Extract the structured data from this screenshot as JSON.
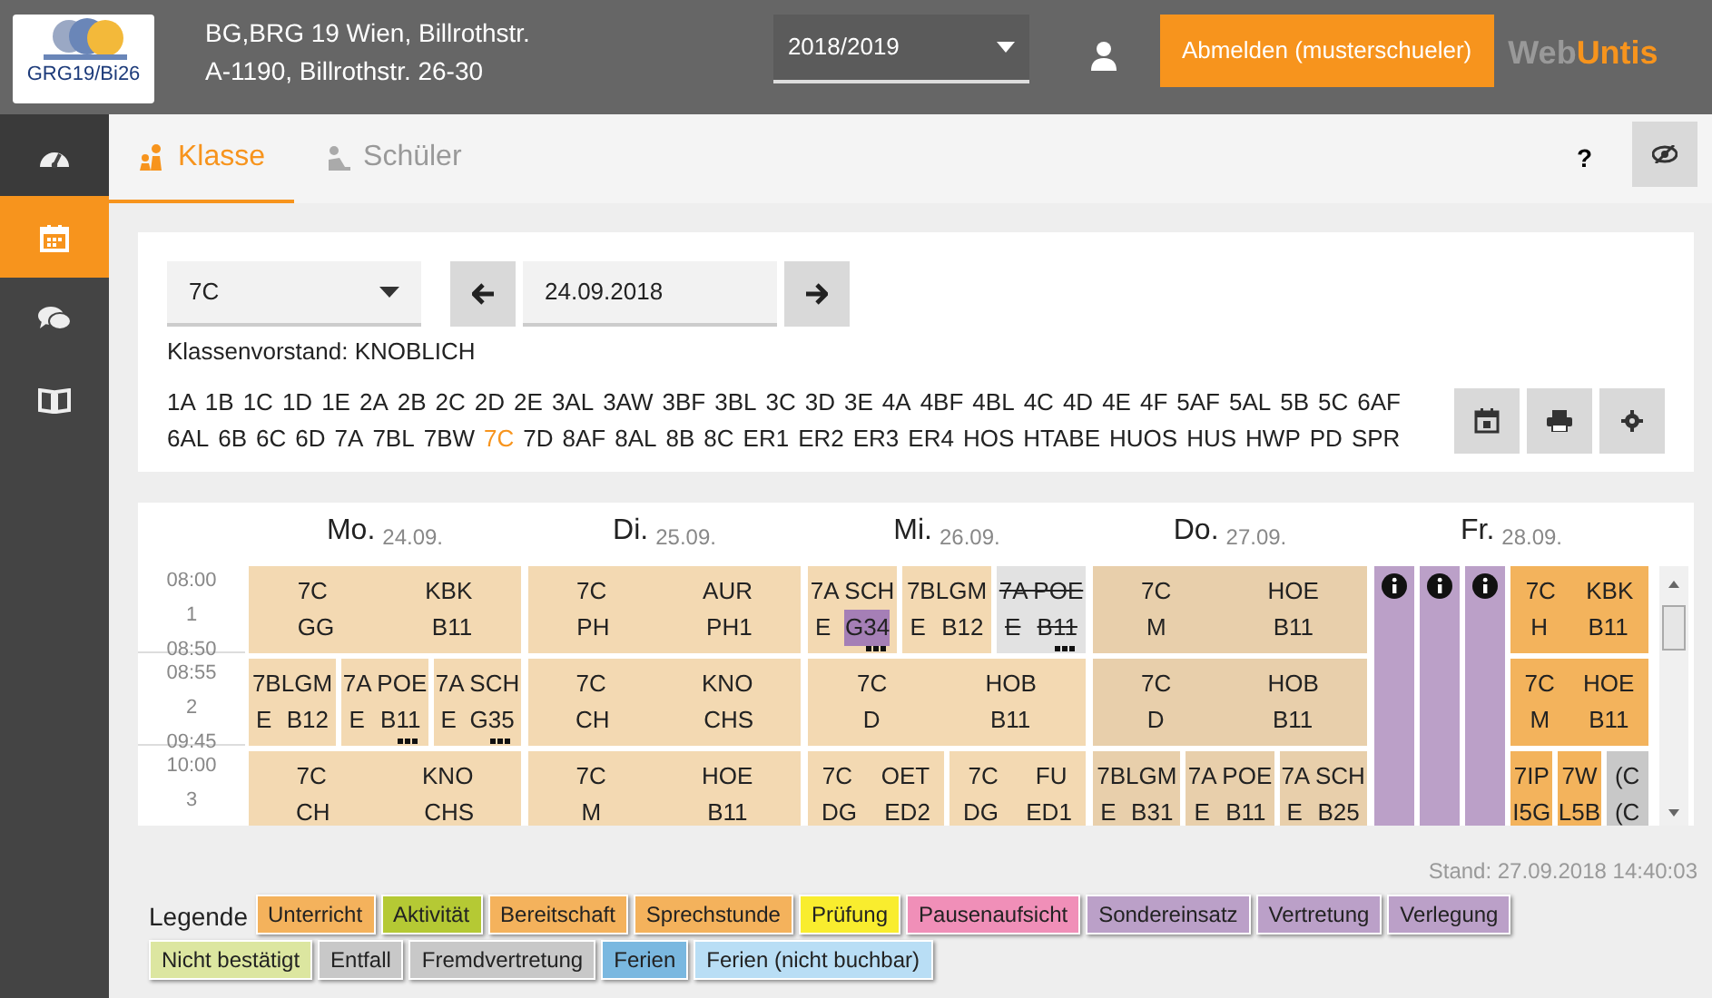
{
  "header": {
    "logo_text": "GRG19/Bi26",
    "school_lines": [
      "BG,BRG 19 Wien, Billrothstr.",
      "A-1190, Billrothstr. 26-30"
    ],
    "school_year": "2018/2019",
    "logout": "Abmelden (musterschueler)",
    "brand": [
      "Web",
      "Untis"
    ]
  },
  "sidebar": [
    {
      "selected": false
    },
    {
      "selected": true
    },
    {
      "selected": false
    },
    {
      "selected": false
    }
  ],
  "tabs": [
    {
      "label": "Klasse",
      "selected": true
    },
    {
      "label": "Schüler",
      "selected": false
    }
  ],
  "toolbar": {
    "help": "?"
  },
  "filter": {
    "class_value": "7C",
    "date": "24.09.2018",
    "class_teacher": "Klassenvorstand: KNOBLICH"
  },
  "classes": [
    {
      "label": "1A",
      "selected": false
    },
    {
      "label": "1B",
      "selected": false
    },
    {
      "label": "1C",
      "selected": false
    },
    {
      "label": "1D",
      "selected": false
    },
    {
      "label": "1E",
      "selected": false
    },
    {
      "label": "2A",
      "selected": false
    },
    {
      "label": "2B",
      "selected": false
    },
    {
      "label": "2C",
      "selected": false
    },
    {
      "label": "2D",
      "selected": false
    },
    {
      "label": "2E",
      "selected": false
    },
    {
      "label": "3AL",
      "selected": false
    },
    {
      "label": "3AW",
      "selected": false
    },
    {
      "label": "3BF",
      "selected": false
    },
    {
      "label": "3BL",
      "selected": false
    },
    {
      "label": "3C",
      "selected": false
    },
    {
      "label": "3D",
      "selected": false
    },
    {
      "label": "3E",
      "selected": false
    },
    {
      "label": "4A",
      "selected": false
    },
    {
      "label": "4BF",
      "selected": false
    },
    {
      "label": "4BL",
      "selected": false
    },
    {
      "label": "4C",
      "selected": false
    },
    {
      "label": "4D",
      "selected": false
    },
    {
      "label": "4E",
      "selected": false
    },
    {
      "label": "4F",
      "selected": false
    },
    {
      "label": "5AF",
      "selected": false
    },
    {
      "label": "5AL",
      "selected": false
    },
    {
      "label": "5B",
      "selected": false
    },
    {
      "label": "5C",
      "selected": false
    },
    {
      "label": "6AF",
      "selected": false
    },
    {
      "label": "6AL",
      "selected": false
    },
    {
      "label": "6B",
      "selected": false
    },
    {
      "label": "6C",
      "selected": false
    },
    {
      "label": "6D",
      "selected": false
    },
    {
      "label": "7A",
      "selected": false
    },
    {
      "label": "7BL",
      "selected": false
    },
    {
      "label": "7BW",
      "selected": false
    },
    {
      "label": "7C",
      "selected": true
    },
    {
      "label": "7D",
      "selected": false
    },
    {
      "label": "8AF",
      "selected": false
    },
    {
      "label": "8AL",
      "selected": false
    },
    {
      "label": "8B",
      "selected": false
    },
    {
      "label": "8C",
      "selected": false
    },
    {
      "label": "ER1",
      "selected": false
    },
    {
      "label": "ER2",
      "selected": false
    },
    {
      "label": "ER3",
      "selected": false
    },
    {
      "label": "ER4",
      "selected": false
    },
    {
      "label": "HOS",
      "selected": false
    },
    {
      "label": "HTABE",
      "selected": false
    },
    {
      "label": "HUOS",
      "selected": false
    },
    {
      "label": "HUS",
      "selected": false
    },
    {
      "label": "HWP",
      "selected": false
    },
    {
      "label": "PD",
      "selected": false
    },
    {
      "label": "SPR",
      "selected": false
    }
  ],
  "periods": [
    {
      "start": "08:00",
      "number": "1",
      "end": "08:50"
    },
    {
      "start": "08:55",
      "number": "2",
      "end": "09:45"
    },
    {
      "start": "10:00",
      "number": "3"
    }
  ],
  "days": [
    {
      "name": "Mo.",
      "date": "24.09.",
      "periods": [
        [
          {
            "top": [
              "7C",
              "KBK"
            ],
            "bottom": [
              "GG",
              "B11"
            ],
            "color": "#f3d9b2",
            "cancelled": false,
            "room_changed": false,
            "more": false
          }
        ],
        [
          {
            "top": [
              "7BLGM"
            ],
            "bottom": [
              "E",
              "B12"
            ],
            "color": "#f3d9b2",
            "cancelled": false,
            "room_changed": false,
            "more": false
          },
          {
            "top": [
              "7A POE"
            ],
            "bottom": [
              "E",
              "B11"
            ],
            "color": "#f3d9b2",
            "cancelled": false,
            "room_changed": false,
            "more": true
          },
          {
            "top": [
              "7A SCH"
            ],
            "bottom": [
              "E",
              "G35"
            ],
            "color": "#f3d9b2",
            "cancelled": false,
            "room_changed": false,
            "more": true
          }
        ],
        [
          {
            "top": [
              "7C",
              "KNO"
            ],
            "bottom": [
              "CH",
              "CHS"
            ],
            "color": "#f3d9b2",
            "cancelled": false,
            "room_changed": false
          }
        ]
      ]
    },
    {
      "name": "Di.",
      "date": "25.09.",
      "periods": [
        [
          {
            "top": [
              "7C",
              "AUR"
            ],
            "bottom": [
              "PH",
              "PH1"
            ],
            "color": "#f3d9b2",
            "cancelled": false,
            "room_changed": false,
            "more": false
          }
        ],
        [
          {
            "top": [
              "7C",
              "KNO"
            ],
            "bottom": [
              "CH",
              "CHS"
            ],
            "color": "#f3d9b2",
            "cancelled": false,
            "room_changed": false,
            "more": false
          }
        ],
        [
          {
            "top": [
              "7C",
              "HOE"
            ],
            "bottom": [
              "M",
              "B11"
            ],
            "color": "#f3d9b2",
            "cancelled": false,
            "room_changed": false
          }
        ]
      ]
    },
    {
      "name": "Mi.",
      "date": "26.09.",
      "periods": [
        [
          {
            "top": [
              "7A SCH"
            ],
            "bottom": [
              "E",
              "G34"
            ],
            "color": "#f3d9b2",
            "cancelled": false,
            "room_changed": true,
            "more": true
          },
          {
            "top": [
              "7BLGM"
            ],
            "bottom": [
              "E",
              "B12"
            ],
            "color": "#f3d9b2",
            "cancelled": false,
            "room_changed": false,
            "more": false
          },
          {
            "top": [
              "7A POE"
            ],
            "bottom": [
              "E",
              "B11"
            ],
            "color": "#e2e2e2",
            "cancelled": true,
            "room_changed": false,
            "more": true
          }
        ],
        [
          {
            "top": [
              "7C",
              "HOB"
            ],
            "bottom": [
              "D",
              "B11"
            ],
            "color": "#f3d9b2",
            "cancelled": false,
            "room_changed": false,
            "more": false
          }
        ],
        [
          {
            "top": [
              "7C",
              "OET"
            ],
            "bottom": [
              "DG",
              "ED2"
            ],
            "color": "#f3d9b2",
            "cancelled": false,
            "room_changed": false
          },
          {
            "top": [
              "7C",
              "FU"
            ],
            "bottom": [
              "DG",
              "ED1"
            ],
            "color": "#f3d9b2",
            "cancelled": false,
            "room_changed": false
          }
        ]
      ]
    },
    {
      "name": "Do.",
      "date": "27.09.",
      "periods": [
        [
          {
            "top": [
              "7C",
              "HOE"
            ],
            "bottom": [
              "M",
              "B11"
            ],
            "color": "#e8cfab",
            "cancelled": false,
            "room_changed": false,
            "more": false
          }
        ],
        [
          {
            "top": [
              "7C",
              "HOB"
            ],
            "bottom": [
              "D",
              "B11"
            ],
            "color": "#e8cfab",
            "cancelled": false,
            "room_changed": false,
            "more": false
          }
        ],
        [
          {
            "top": [
              "7BLGM"
            ],
            "bottom": [
              "E",
              "B31"
            ],
            "color": "#e8cfab",
            "cancelled": false,
            "room_changed": false
          },
          {
            "top": [
              "7A POE"
            ],
            "bottom": [
              "E",
              "B11"
            ],
            "color": "#e8cfab",
            "cancelled": false,
            "room_changed": false
          },
          {
            "top": [
              "7A SCH"
            ],
            "bottom": [
              "E",
              "B25"
            ],
            "color": "#e8cfab",
            "cancelled": false,
            "room_changed": false
          }
        ]
      ]
    },
    {
      "name": "Fr.",
      "date": "28.09.",
      "events": [
        {
          "color": "#bba0c8"
        },
        {
          "color": "#bba0c8"
        },
        {
          "color": "#bba0c8"
        }
      ],
      "periods": [
        [
          {
            "top": [
              "7C",
              "KBK"
            ],
            "bottom": [
              "H",
              "B11"
            ],
            "color": "#f3b35c",
            "cancelled": false,
            "room_changed": false,
            "more": false
          }
        ],
        [
          {
            "top": [
              "7C",
              "HOE"
            ],
            "bottom": [
              "M",
              "B11"
            ],
            "color": "#f3b35c",
            "cancelled": false,
            "room_changed": false,
            "more": false
          }
        ],
        [
          {
            "top": [
              "7IP"
            ],
            "bottom": [
              "I5G"
            ],
            "color": "#f3b35c",
            "cancelled": false,
            "room_changed": false
          },
          {
            "top": [
              "7W"
            ],
            "bottom": [
              "L5B"
            ],
            "color": "#f3b35c",
            "cancelled": false,
            "room_changed": false
          },
          {
            "top": [
              "(C"
            ],
            "bottom": [
              "(C"
            ],
            "color": "#c8c8c8",
            "cancelled": false,
            "room_changed": false
          }
        ]
      ]
    }
  ],
  "status": "Stand: 27.09.2018 14:40:03",
  "legend": {
    "title": "Legende",
    "items": [
      {
        "label": "Unterricht",
        "color": "#f4b25c"
      },
      {
        "label": "Aktivität",
        "color": "#b5c934"
      },
      {
        "label": "Bereitschaft",
        "color": "#f4b25c"
      },
      {
        "label": "Sprechstunde",
        "color": "#f4b25c"
      },
      {
        "label": "Prüfung",
        "color": "#f9ed2e"
      },
      {
        "label": "Pausenaufsicht",
        "color": "#f08fb8"
      },
      {
        "label": "Sondereinsatz",
        "color": "#bba0c8"
      },
      {
        "label": "Vertretung",
        "color": "#bba0c8"
      },
      {
        "label": "Verlegung",
        "color": "#bba0c8"
      },
      {
        "label": "Nicht bestätigt",
        "color": "#dce6a0"
      },
      {
        "label": "Entfall",
        "color": "#c8c8c8"
      },
      {
        "label": "Fremdvertretung",
        "color": "#c8c8c8"
      },
      {
        "label": "Ferien",
        "color": "#7ab8e0"
      },
      {
        "label": "Ferien (nicht buchbar)",
        "color": "#b9def5"
      }
    ]
  }
}
